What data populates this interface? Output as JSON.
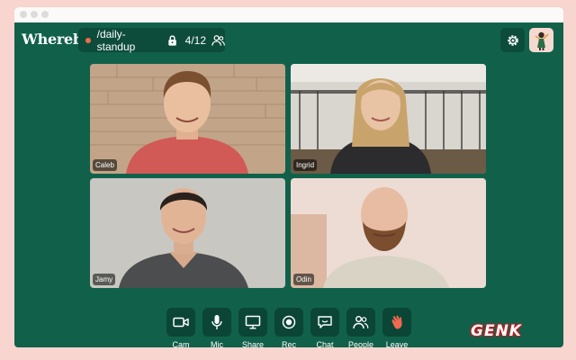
{
  "brand": {
    "logo": "Whereby"
  },
  "room": {
    "name": "/daily-standup",
    "occupancy": "4/12",
    "locked": true
  },
  "participants": [
    {
      "name": "Caleb"
    },
    {
      "name": "Ingrid"
    },
    {
      "name": "Jamy"
    },
    {
      "name": "Odin"
    }
  ],
  "controls": [
    {
      "id": "cam",
      "label": "Cam",
      "icon": "camera-icon"
    },
    {
      "id": "mic",
      "label": "Mic",
      "icon": "microphone-icon"
    },
    {
      "id": "share",
      "label": "Share",
      "icon": "screen-share-icon"
    },
    {
      "id": "rec",
      "label": "Rec",
      "icon": "record-icon"
    },
    {
      "id": "chat",
      "label": "Chat",
      "icon": "chat-icon"
    },
    {
      "id": "people",
      "label": "People",
      "icon": "people-icon"
    },
    {
      "id": "leave",
      "label": "Leave",
      "icon": "waving-hand-icon"
    }
  ],
  "watermark": {
    "text": "GENK"
  },
  "colors": {
    "background": "#f8d5cf",
    "window": "#11614a",
    "button": "#0b4535",
    "rec_dot": "#f26b4a",
    "leave_icon": "#f06a4d"
  }
}
